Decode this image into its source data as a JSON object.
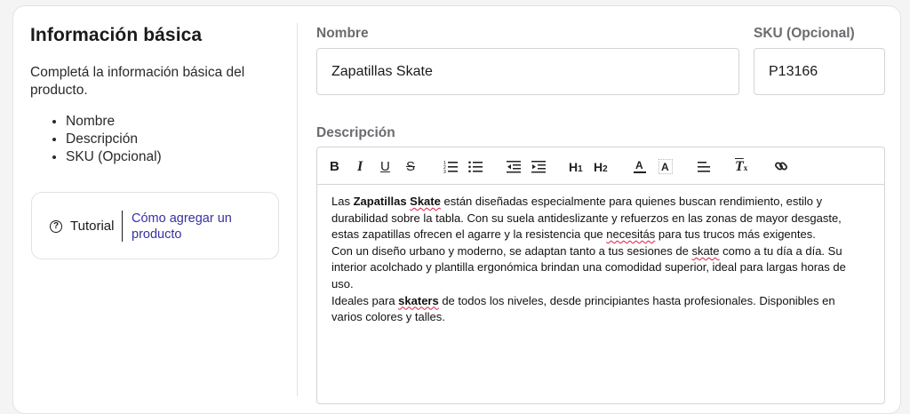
{
  "left": {
    "title": "Información básica",
    "description": "Completá la información básica del producto.",
    "bullets": [
      "Nombre",
      "Descripción",
      "SKU (Opcional)"
    ],
    "tutorial": {
      "label": "Tutorial",
      "link": "Cómo agregar un producto"
    }
  },
  "form": {
    "name": {
      "label": "Nombre",
      "value": "Zapatillas Skate"
    },
    "sku": {
      "label": "SKU (Opcional)",
      "value": "P13166"
    },
    "description_label": "Descripción"
  },
  "toolbar": [
    "bold-icon",
    "italic-icon",
    "underline-icon",
    "strikethrough-icon",
    "ordered-list-icon",
    "bullet-list-icon",
    "outdent-icon",
    "indent-icon",
    "heading-1-icon",
    "heading-2-icon",
    "text-color-icon",
    "highlight-icon",
    "align-icon",
    "clear-format-icon",
    "link-icon"
  ],
  "content": {
    "p1": {
      "t1": "Las ",
      "b1": "Zapatillas ",
      "b2": "Skate",
      "t2": " están diseñadas especialmente para quienes buscan rendimiento, estilo y durabilidad sobre la tabla. Con su suela antideslizante y refuerzos en las zonas de mayor desgaste, estas zapatillas ofrecen el agarre y la resistencia que ",
      "w1": "necesitás",
      "t3": " para tus trucos más exigentes."
    },
    "p2": {
      "t1": "Con un diseño urbano y moderno, se adaptan tanto a tus sesiones de ",
      "w1": "skate",
      "t2": " como a tu día a día. Su interior acolchado y plantilla ergonómica brindan una comodidad superior, ideal para largas horas de uso."
    },
    "p3": {
      "t1": "Ideales para ",
      "b1": "skaters",
      "t2": " de todos los niveles, desde principiantes hasta profesionales. Disponibles en varios colores y talles."
    }
  },
  "colors": {
    "link": "#3730a3",
    "label": "#6b6b70",
    "border": "#d4d4d8",
    "spell": "#e11d48"
  }
}
